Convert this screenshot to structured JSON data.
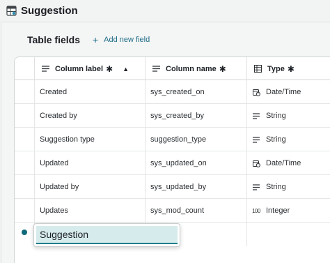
{
  "header": {
    "title": "Suggestion",
    "icon": "table-icon"
  },
  "section": {
    "title": "Table fields",
    "add_label": "Add new field",
    "add_icon": "plus-icon"
  },
  "table": {
    "columns": [
      {
        "label": "Column label",
        "required": "✱",
        "icon": "text-lines-icon",
        "sort": "▲"
      },
      {
        "label": "Column name",
        "required": "✱",
        "icon": "text-lines-icon"
      },
      {
        "label": "Type",
        "required": "✱",
        "icon": "table-grid-icon"
      }
    ],
    "rows": [
      {
        "label": "Created",
        "name": "sys_created_on",
        "type": "Date/Time",
        "type_icon": "calendar-clock-icon"
      },
      {
        "label": "Created by",
        "name": "sys_created_by",
        "type": "String",
        "type_icon": "text-lines-icon"
      },
      {
        "label": "Suggestion type",
        "name": "suggestion_type",
        "type": "String",
        "type_icon": "text-lines-icon"
      },
      {
        "label": "Updated",
        "name": "sys_updated_on",
        "type": "Date/Time",
        "type_icon": "calendar-clock-icon"
      },
      {
        "label": "Updated by",
        "name": "sys_updated_by",
        "type": "String",
        "type_icon": "text-lines-icon"
      },
      {
        "label": "Updates",
        "name": "sys_mod_count",
        "type": "Integer",
        "type_icon": "number-icon",
        "type_icon_text": "100"
      }
    ]
  },
  "editor": {
    "value": "Suggestion"
  },
  "colors": {
    "accent": "#1d6c86",
    "edit_highlight": "#d6ebec",
    "new_row_dot": "#0f6a7a"
  }
}
